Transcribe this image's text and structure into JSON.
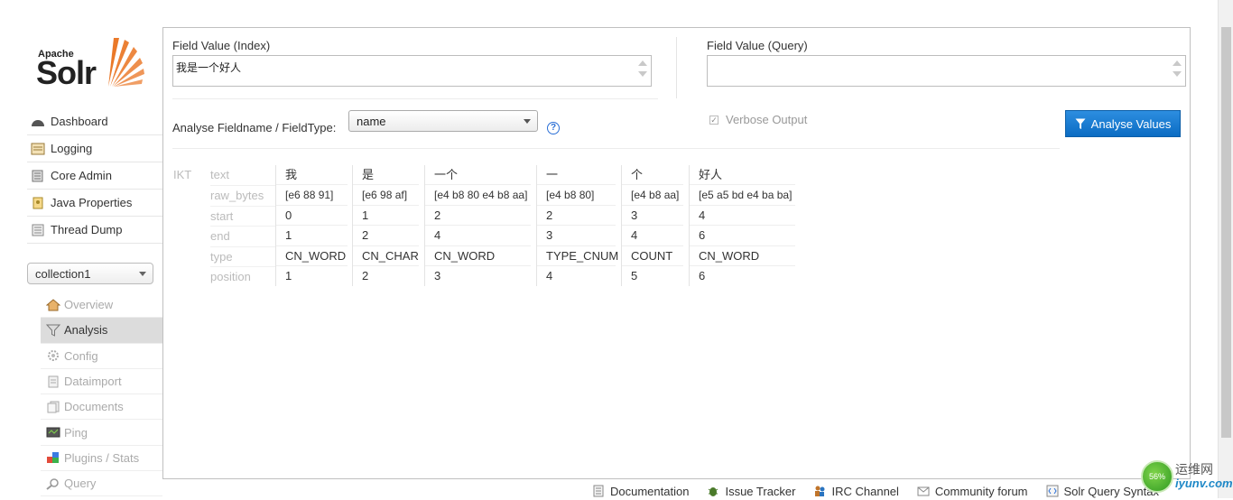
{
  "logo": {
    "apache": "Apache",
    "solr": "Solr"
  },
  "nav": [
    {
      "label": "Dashboard",
      "icon": "dashboard-icon"
    },
    {
      "label": "Logging",
      "icon": "logging-icon"
    },
    {
      "label": "Core Admin",
      "icon": "core-admin-icon"
    },
    {
      "label": "Java Properties",
      "icon": "java-properties-icon"
    },
    {
      "label": "Thread Dump",
      "icon": "thread-dump-icon"
    }
  ],
  "core_selector": {
    "value": "collection1"
  },
  "core_nav": [
    {
      "label": "Overview",
      "icon": "overview-icon"
    },
    {
      "label": "Analysis",
      "icon": "analysis-icon",
      "active": true
    },
    {
      "label": "Config",
      "icon": "config-icon"
    },
    {
      "label": "Dataimport",
      "icon": "dataimport-icon"
    },
    {
      "label": "Documents",
      "icon": "documents-icon"
    },
    {
      "label": "Ping",
      "icon": "ping-icon"
    },
    {
      "label": "Plugins / Stats",
      "icon": "plugins-icon"
    },
    {
      "label": "Query",
      "icon": "query-icon"
    }
  ],
  "analysis": {
    "index_label": "Field Value (Index)",
    "index_value": "我是一个好人",
    "query_label": "Field Value (Query)",
    "query_value": "",
    "fieldtype_label": "Analyse Fieldname / FieldType:",
    "fieldtype_value": "name",
    "help": "?",
    "verbose_label": "Verbose Output",
    "verbose_checked": true,
    "analyse_button": "Analyse Values",
    "analyzer": "IKT",
    "row_labels": [
      "text",
      "raw_bytes",
      "start",
      "end",
      "type",
      "position"
    ],
    "tokens": [
      {
        "text": "我",
        "raw_bytes": "[e6 88 91]",
        "start": "0",
        "end": "1",
        "type": "CN_WORD",
        "position": "1"
      },
      {
        "text": "是",
        "raw_bytes": "[e6 98 af]",
        "start": "1",
        "end": "2",
        "type": "CN_CHAR",
        "position": "2"
      },
      {
        "text": "一个",
        "raw_bytes": "[e4 b8 80 e4 b8 aa]",
        "start": "2",
        "end": "4",
        "type": "CN_WORD",
        "position": "3"
      },
      {
        "text": "一",
        "raw_bytes": "[e4 b8 80]",
        "start": "2",
        "end": "3",
        "type": "TYPE_CNUM",
        "position": "4"
      },
      {
        "text": "个",
        "raw_bytes": "[e4 b8 aa]",
        "start": "3",
        "end": "4",
        "type": "COUNT",
        "position": "5"
      },
      {
        "text": "好人",
        "raw_bytes": "[e5 a5 bd e4 ba ba]",
        "start": "4",
        "end": "6",
        "type": "CN_WORD",
        "position": "6"
      }
    ]
  },
  "footer": [
    {
      "label": "Documentation",
      "icon": "documentation-icon"
    },
    {
      "label": "Issue Tracker",
      "icon": "bug-icon"
    },
    {
      "label": "IRC Channel",
      "icon": "irc-icon"
    },
    {
      "label": "Community forum",
      "icon": "mail-icon"
    },
    {
      "label": "Solr Query Syntax",
      "icon": "syntax-icon"
    }
  ],
  "watermark": {
    "percent": "56%",
    "title": "运维网",
    "site": "iyunv.com"
  },
  "colors": {
    "accent": "#1a7bd4",
    "active_bg": "#dcdcdc",
    "muted_text": "#aaaaaa",
    "logo_orange": "#e86a12"
  }
}
